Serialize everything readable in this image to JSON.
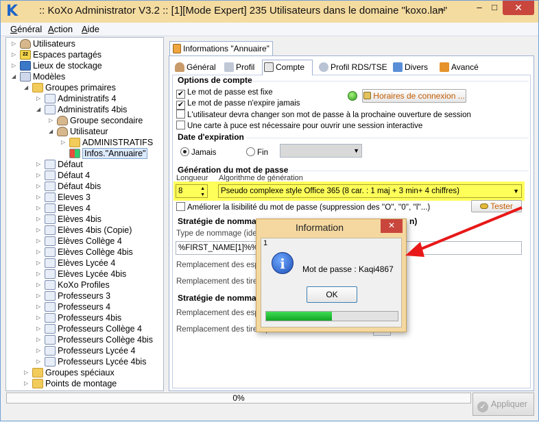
{
  "window": {
    "title": ":: KoXo Administrator V3.2 :: [1][Mode Expert] 235 Utilisateurs dans le domaine \"koxo.lan\"",
    "resize_glyph": "↔",
    "minimize": "–",
    "maximize": "□",
    "close": "✕",
    "logo": "K"
  },
  "menu": [
    {
      "underline": "G",
      "rest": "énéral"
    },
    {
      "underline": "A",
      "rest": "ction"
    },
    {
      "underline": "A",
      "rest": "ide"
    }
  ],
  "tree": [
    {
      "label": "Utilisateurs",
      "icon": "people-icon",
      "level": 0,
      "expander": "▷"
    },
    {
      "label": "Espaces partagés",
      "icon": "shared-space-icon",
      "level": 0,
      "expander": "▷",
      "icon_text": "22"
    },
    {
      "label": "Lieux de stockage",
      "icon": "storage-icon",
      "level": 0,
      "expander": "▷"
    },
    {
      "label": "Modèles",
      "icon": "models-icon",
      "level": 0,
      "expander": "◢"
    },
    {
      "label": "Groupes primaires",
      "icon": "folder-icon",
      "level": 1,
      "expander": "◢"
    },
    {
      "label": "Administratifs 4",
      "icon": "document-icon",
      "level": 2,
      "expander": "▷"
    },
    {
      "label": "Administratifs 4bis",
      "icon": "document-icon",
      "level": 2,
      "expander": "◢"
    },
    {
      "label": "Groupe secondaire",
      "icon": "group-icon",
      "level": 3,
      "expander": "▷"
    },
    {
      "label": "Utilisateur",
      "icon": "user-icon",
      "level": 3,
      "expander": "◢"
    },
    {
      "label": "ADMINISTRATIFS",
      "icon": "folder-icon",
      "level": 4,
      "expander": "▷"
    },
    {
      "label": "Infos.\"Annuaire\"",
      "icon": "windows-icon",
      "level": 4,
      "expander": "",
      "selected": true
    },
    {
      "label": "Défaut",
      "icon": "document-icon",
      "level": 2,
      "expander": "▷"
    },
    {
      "label": "Défaut 4",
      "icon": "document-icon",
      "level": 2,
      "expander": "▷"
    },
    {
      "label": "Défaut 4bis",
      "icon": "document-icon",
      "level": 2,
      "expander": "▷"
    },
    {
      "label": "Eleves 3",
      "icon": "document-icon",
      "level": 2,
      "expander": "▷"
    },
    {
      "label": "Eleves 4",
      "icon": "document-icon",
      "level": 2,
      "expander": "▷"
    },
    {
      "label": "Elèves 4bis",
      "icon": "document-icon",
      "level": 2,
      "expander": "▷"
    },
    {
      "label": "Elèves 4bis (Copie)",
      "icon": "document-icon",
      "level": 2,
      "expander": "▷"
    },
    {
      "label": "Elèves Collège 4",
      "icon": "document-icon",
      "level": 2,
      "expander": "▷"
    },
    {
      "label": "Elèves Collège 4bis",
      "icon": "document-icon",
      "level": 2,
      "expander": "▷"
    },
    {
      "label": "Elèves Lycée 4",
      "icon": "document-icon",
      "level": 2,
      "expander": "▷"
    },
    {
      "label": "Elèves Lycée 4bis",
      "icon": "document-icon",
      "level": 2,
      "expander": "▷"
    },
    {
      "label": "KoXo Profiles",
      "icon": "document-icon",
      "level": 2,
      "expander": "▷"
    },
    {
      "label": "Professeurs 3",
      "icon": "document-icon",
      "level": 2,
      "expander": "▷"
    },
    {
      "label": "Professeurs 4",
      "icon": "document-icon",
      "level": 2,
      "expander": "▷"
    },
    {
      "label": "Professeurs 4bis",
      "icon": "document-icon",
      "level": 2,
      "expander": "▷"
    },
    {
      "label": "Professeurs Collège 4",
      "icon": "document-icon",
      "level": 2,
      "expander": "▷"
    },
    {
      "label": "Professeurs Collège 4bis",
      "icon": "document-icon",
      "level": 2,
      "expander": "▷"
    },
    {
      "label": "Professeurs Lycée 4",
      "icon": "document-icon",
      "level": 2,
      "expander": "▷"
    },
    {
      "label": "Professeurs Lycée 4bis",
      "icon": "document-icon",
      "level": 2,
      "expander": "▷"
    },
    {
      "label": "Groupes spéciaux",
      "icon": "folder-icon",
      "level": 1,
      "expander": "▷"
    },
    {
      "label": "Points de montage",
      "icon": "folder-icon",
      "level": 1,
      "expander": "▷"
    }
  ],
  "panel": {
    "outer_tab": "Informations \"Annuaire\"",
    "tabs": [
      "Général",
      "Profil",
      "Compte",
      "Profil RDS/TSE",
      "Divers",
      "Avancé"
    ],
    "active_tab": "Compte"
  },
  "account": {
    "options_title": "Options de compte",
    "options": [
      {
        "label": "Le mot de passe est fixe",
        "checked": true
      },
      {
        "label": "Le mot de passe n'expire jamais",
        "checked": true
      },
      {
        "label": "L'utilisateur devra changer son mot de passe à la prochaine ouverture de session",
        "checked": false
      },
      {
        "label": "Une carte à puce est nécessaire pour ouvrir une session interactive",
        "checked": false
      }
    ],
    "check_mark": "✔",
    "hours_button": "Horaires de connexion ...",
    "expiry_title": "Date d'expiration",
    "expiry_never": "Jamais",
    "expiry_end": "Fin",
    "password_title": "Génération du mot de passe",
    "length_label": "Longueur",
    "algorithm_label": "Algorithme de génération",
    "length_value": "8",
    "algorithm_value": "Pseudo complexe style Office 365 (8 car. : 1 maj + 3 min+ 4 chiffres)",
    "readability_label": "Améliorer la lisibilité du mot de passe (suppression des ''O'', ''0'', ''l''...)",
    "test_button": "Tester",
    "naming_title_1": "Stratégie de nomma",
    "naming_title_1_tail": "n)",
    "naming_type_label": "Type de nommage (ident",
    "naming_value": "%FIRST_NAME[1]%%NA",
    "replace_spaces_1": "Remplacement des espac",
    "replace_dashes_1": "Remplacement des tirets",
    "naming_title_2": "Stratégie de nomma",
    "replace_spaces_2": "Remplacement des espac",
    "replace_dashes_2": "Remplacement des tirets par"
  },
  "dialog": {
    "title": "Information",
    "close": "✕",
    "counter": "1",
    "icon_glyph": "i",
    "message": "Mot de passe : Kaqi4867",
    "ok": "OK",
    "progress": 0.5
  },
  "bottom": {
    "progress_text": "0%",
    "apply_button": "Appliquer",
    "apply_icon": "✓"
  },
  "colors": {
    "title_bar": "#f4dba0",
    "close_button": "#c9463d",
    "highlight_yellow": "#ffff5a",
    "arrow_red": "#e81818"
  }
}
